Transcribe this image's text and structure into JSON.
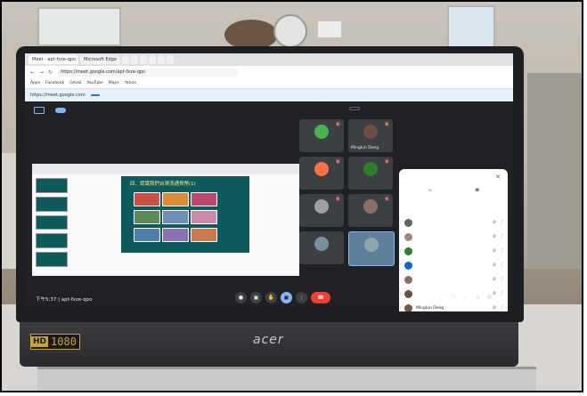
{
  "browser": {
    "tabs": [
      "Meet - apt-fxze-qpo",
      "Microsoft Edge",
      "",
      "",
      "",
      "",
      "",
      ""
    ],
    "url": "https://meet.google.com/apt-fxze-qpo",
    "bookmarks": [
      "Apps",
      "Facebook",
      "Gmail",
      "YouTube",
      "Maps",
      "Yahoo",
      "",
      "",
      "",
      ""
    ],
    "infobar": {
      "text": "https://meet.google.com",
      "button": ""
    }
  },
  "meet": {
    "presenting_text": "",
    "stop_button": "",
    "meeting_time": "下午5:37",
    "meeting_code": "apt-fxze-qpo",
    "slide": {
      "title": "四、認識我們台灣流通貨幣(1)"
    },
    "tiles": [
      {
        "name": "",
        "color": "#4caf50"
      },
      {
        "name": "Minglun Deng",
        "color": "#6d4c41"
      },
      {
        "name": "",
        "color": "#ff7043"
      },
      {
        "name": "",
        "color": "#2e7d32"
      },
      {
        "name": "",
        "color": "#9e9e9e"
      },
      {
        "name": "",
        "color": "#8d6e63"
      },
      {
        "name": "",
        "color": "#78909c"
      },
      {
        "name": "",
        "color": "#90a4ae"
      }
    ],
    "people_panel": {
      "title": "",
      "actions": [
        "",
        ""
      ],
      "participants": [
        {
          "name": "",
          "color": "#5f6368"
        },
        {
          "name": "",
          "color": "#a1887f"
        },
        {
          "name": "",
          "color": "#2e7d32"
        },
        {
          "name": "",
          "color": "#1565c0"
        },
        {
          "name": "",
          "color": "#8d6e63"
        },
        {
          "name": "",
          "color": "#6d4c41"
        },
        {
          "name": "Minglun Deng",
          "color": "#795548"
        },
        {
          "name": "",
          "color": "#f9a825"
        }
      ]
    }
  },
  "laptop": {
    "brand": "acer",
    "badge_hd": "HD",
    "badge_res": "1080"
  }
}
